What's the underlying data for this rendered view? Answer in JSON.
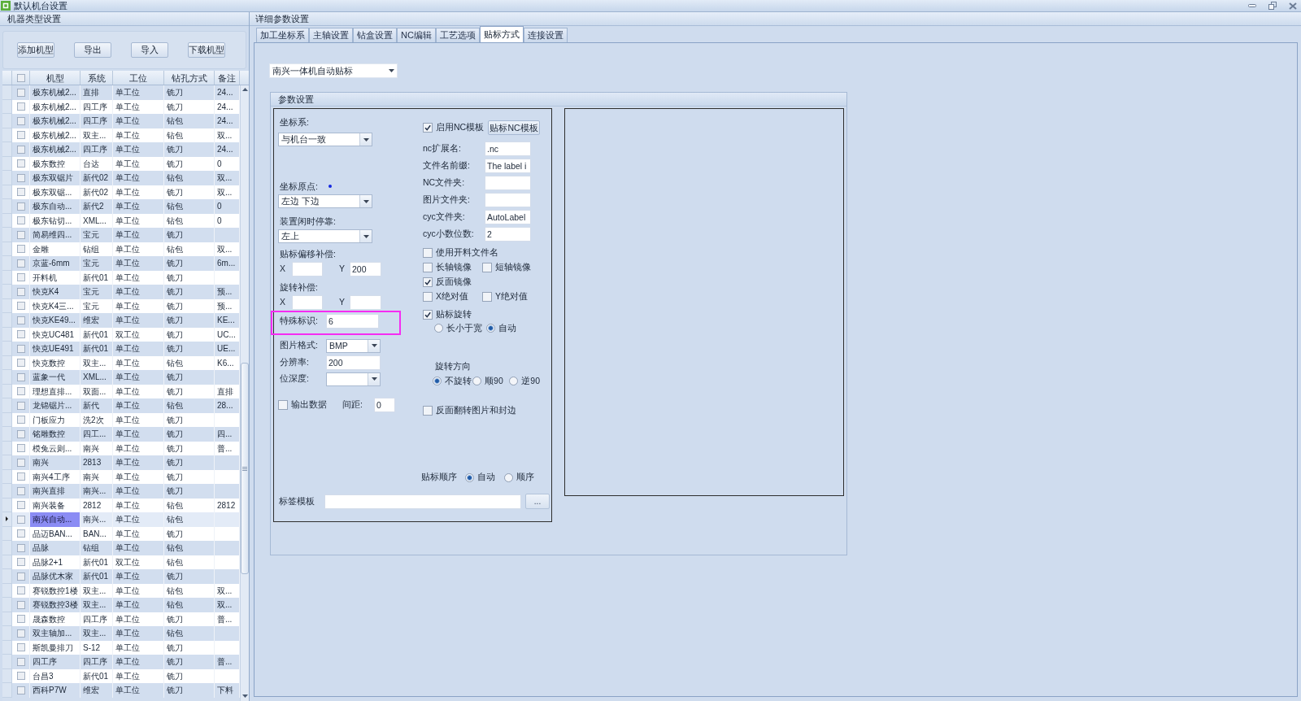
{
  "window": {
    "title": "默认机台设置"
  },
  "machine_types": {
    "title": "机器类型设置",
    "buttons": [
      "添加机型",
      "导出",
      "导入",
      "下载机型"
    ],
    "table": {
      "all_checked": false,
      "columns": [
        "机型",
        "系统",
        "工位",
        "钻孔方式",
        "备注"
      ],
      "rows": [
        {
          "model": "极东机械2...",
          "system": "直排",
          "station": "单工位",
          "drilling": "铣刀",
          "remark": "24...",
          "checked": false,
          "selected": false
        },
        {
          "model": "极东机械2...",
          "system": "四工序",
          "station": "单工位",
          "drilling": "铣刀",
          "remark": "24...",
          "checked": false,
          "selected": false
        },
        {
          "model": "极东机械2...",
          "system": "四工序",
          "station": "单工位",
          "drilling": "钻包",
          "remark": "24...",
          "checked": false,
          "selected": false
        },
        {
          "model": "极东机械2...",
          "system": "双主...",
          "station": "单工位",
          "drilling": "钻包",
          "remark": "双...",
          "checked": false,
          "selected": false
        },
        {
          "model": "极东机械2...",
          "system": "四工序",
          "station": "单工位",
          "drilling": "铣刀",
          "remark": "24...",
          "checked": false,
          "selected": false
        },
        {
          "model": "极东数控",
          "system": "台达",
          "station": "单工位",
          "drilling": "铣刀",
          "remark": "0",
          "checked": false,
          "selected": false
        },
        {
          "model": "极东双锯片",
          "system": "新代02",
          "station": "单工位",
          "drilling": "钻包",
          "remark": "双...",
          "checked": false,
          "selected": false
        },
        {
          "model": "极东双锯...",
          "system": "新代02",
          "station": "单工位",
          "drilling": "铣刀",
          "remark": "双...",
          "checked": false,
          "selected": false
        },
        {
          "model": "极东自动...",
          "system": "新代2",
          "station": "单工位",
          "drilling": "钻包",
          "remark": "0",
          "checked": false,
          "selected": false
        },
        {
          "model": "极东钻切...",
          "system": "XML...",
          "station": "单工位",
          "drilling": "钻包",
          "remark": "0",
          "checked": false,
          "selected": false
        },
        {
          "model": "简易维四...",
          "system": "宝元",
          "station": "单工位",
          "drilling": "铣刀",
          "checked": false,
          "selected": false
        },
        {
          "model": "金雕",
          "system": "钻组",
          "station": "单工位",
          "drilling": "钻包",
          "remark": "双...",
          "checked": false,
          "selected": false
        },
        {
          "model": "京蓝-6mm",
          "system": "宝元",
          "station": "单工位",
          "drilling": "铣刀",
          "remark": "6m...",
          "checked": false,
          "selected": false
        },
        {
          "model": "开料机",
          "system": "新代01",
          "station": "单工位",
          "drilling": "铣刀",
          "checked": false,
          "selected": false
        },
        {
          "model": "快克K4",
          "system": "宝元",
          "station": "单工位",
          "drilling": "铣刀",
          "remark": "预...",
          "checked": false,
          "selected": false
        },
        {
          "model": "快克K4三...",
          "system": "宝元",
          "station": "单工位",
          "drilling": "铣刀",
          "remark": "预...",
          "checked": false,
          "selected": false
        },
        {
          "model": "快克KE49...",
          "system": "维宏",
          "station": "单工位",
          "drilling": "铣刀",
          "remark": "KE...",
          "checked": false,
          "selected": false
        },
        {
          "model": "快克UC481",
          "system": "新代01",
          "station": "双工位",
          "drilling": "铣刀",
          "remark": "UC...",
          "checked": false,
          "selected": false
        },
        {
          "model": "快克UE491",
          "system": "新代01",
          "station": "单工位",
          "drilling": "铣刀",
          "remark": "UE...",
          "checked": false,
          "selected": false
        },
        {
          "model": "快克数控",
          "system": "双主...",
          "station": "单工位",
          "drilling": "钻包",
          "remark": "K6...",
          "checked": false,
          "selected": false
        },
        {
          "model": "蓝象一代",
          "system": "XML...",
          "station": "单工位",
          "drilling": "铣刀",
          "checked": false,
          "selected": false
        },
        {
          "model": "理想直排...",
          "system": "双面...",
          "station": "单工位",
          "drilling": "铣刀",
          "remark": "直排",
          "checked": false,
          "selected": false
        },
        {
          "model": "龙锦锯片...",
          "system": "新代",
          "station": "单工位",
          "drilling": "钻包",
          "remark": "28...",
          "checked": false,
          "selected": false
        },
        {
          "model": "门板应力",
          "system": "洗2次",
          "station": "单工位",
          "drilling": "铣刀",
          "checked": false,
          "selected": false
        },
        {
          "model": "铭雕数控",
          "system": "四工...",
          "station": "单工位",
          "drilling": "铣刀",
          "remark": "四...",
          "checked": false,
          "selected": false
        },
        {
          "model": "模兔云则...",
          "system": "南兴",
          "station": "单工位",
          "drilling": "铣刀",
          "remark": "普...",
          "checked": false,
          "selected": false
        },
        {
          "model": "南兴",
          "system": "2813",
          "station": "单工位",
          "drilling": "铣刀",
          "checked": false,
          "selected": false
        },
        {
          "model": "南兴4工序",
          "system": "南兴",
          "station": "单工位",
          "drilling": "铣刀",
          "checked": false,
          "selected": false
        },
        {
          "model": "南兴直排",
          "system": "南兴...",
          "station": "单工位",
          "drilling": "铣刀",
          "checked": false,
          "selected": false
        },
        {
          "model": "南兴装备",
          "system": "2812",
          "station": "单工位",
          "drilling": "钻包",
          "remark": "2812",
          "checked": false,
          "selected": false
        },
        {
          "model": "南兴自动...",
          "system": "南兴...",
          "station": "单工位",
          "drilling": "钻包",
          "checked": false,
          "selected": true
        },
        {
          "model": "品迈BAN...",
          "system": "BAN...",
          "station": "单工位",
          "drilling": "铣刀",
          "checked": false,
          "selected": false
        },
        {
          "model": "品脉",
          "system": "钻组",
          "station": "单工位",
          "drilling": "钻包",
          "checked": false,
          "selected": false
        },
        {
          "model": "品脉2+1",
          "system": "新代01",
          "station": "双工位",
          "drilling": "钻包",
          "checked": false,
          "selected": false
        },
        {
          "model": "品脉优木家",
          "system": "新代01",
          "station": "单工位",
          "drilling": "铣刀",
          "checked": false,
          "selected": false
        },
        {
          "model": "赛锐数控1楼",
          "system": "双主...",
          "station": "单工位",
          "drilling": "钻包",
          "remark": "双...",
          "checked": false,
          "selected": false
        },
        {
          "model": "赛锐数控3楼",
          "system": "双主...",
          "station": "单工位",
          "drilling": "钻包",
          "remark": "双...",
          "checked": false,
          "selected": false
        },
        {
          "model": "晟森数控",
          "system": "四工序",
          "station": "单工位",
          "drilling": "铣刀",
          "remark": "普...",
          "checked": false,
          "selected": false
        },
        {
          "model": "双主轴加...",
          "system": "双主...",
          "station": "单工位",
          "drilling": "钻包",
          "checked": false,
          "selected": false
        },
        {
          "model": "斯凯曼排刀",
          "system": "S-12",
          "station": "单工位",
          "drilling": "铣刀",
          "checked": false,
          "selected": false
        },
        {
          "model": "四工序",
          "system": "四工序",
          "station": "单工位",
          "drilling": "铣刀",
          "remark": "普...",
          "checked": false,
          "selected": false
        },
        {
          "model": "台昌3",
          "system": "新代01",
          "station": "单工位",
          "drilling": "铣刀",
          "checked": false,
          "selected": false
        },
        {
          "model": "西科P7W",
          "system": "维宏",
          "station": "单工位",
          "drilling": "铣刀",
          "remark": "下料",
          "checked": false,
          "selected": false
        }
      ]
    }
  },
  "details": {
    "title": "详细参数设置",
    "tabs": [
      {
        "label": "加工坐标系",
        "selected": false
      },
      {
        "label": "主轴设置",
        "selected": false
      },
      {
        "label": "钻盒设置",
        "selected": false
      },
      {
        "label": "NC编辑",
        "selected": false
      },
      {
        "label": "工艺选项",
        "selected": false
      },
      {
        "label": "贴标方式",
        "selected": true
      },
      {
        "label": "连接设置",
        "selected": false
      }
    ],
    "preset": {
      "value": "南兴一体机自动贴标"
    },
    "params": {
      "title": "参数设置",
      "coordinate_system": {
        "label": "坐标系:",
        "value": "与机台一致"
      },
      "origin": {
        "label": "坐标原点:",
        "value": "左边 下边"
      },
      "idle_position": {
        "label": "装置闲时停靠:",
        "value": "左上"
      },
      "label_offset": {
        "label": "贴标偏移补偿:",
        "x_label": "X",
        "y_label": "Y",
        "y_value": "200"
      },
      "rotation_offset": {
        "label": "旋转补偿:",
        "x_label": "X",
        "y_label": "Y"
      },
      "special_mark": {
        "label": "特殊标识:",
        "value": "6",
        "highlighted": true
      },
      "image_format": {
        "label": "图片格式:",
        "value": "BMP"
      },
      "resolution": {
        "label": "分辨率:",
        "value": "200"
      },
      "bit_depth": {
        "label": "位深度:"
      },
      "output_data": {
        "label": "输出数据",
        "checked": false
      },
      "spacing": {
        "label": "间距:",
        "value": "0"
      },
      "nc_template": {
        "label": "启用NC模板",
        "checked": true,
        "button": "贴标NC模板"
      },
      "text_fields": [
        {
          "label": "nc扩展名:",
          "value": ".nc"
        },
        {
          "label": "文件名前缀:",
          "value": "The label i"
        },
        {
          "label": "NC文件夹:"
        },
        {
          "label": "图片文件夹:"
        },
        {
          "label": "cyc文件夹:",
          "value": "AutoLabel"
        },
        {
          "label": "cyc小数位数:",
          "value": "2"
        }
      ],
      "option_rows": [
        {
          "items": [
            {
              "label": "使用开料文件名",
              "checked": false
            }
          ]
        },
        {
          "items": [
            {
              "label": "长轴镜像",
              "checked": false
            },
            {
              "label": "短轴镜像",
              "checked": false
            }
          ]
        },
        {
          "items": [
            {
              "label": "反面镜像",
              "checked": true
            }
          ]
        },
        {
          "items": [
            {
              "label": "X绝对值",
              "checked": false
            },
            {
              "label": "Y绝对值",
              "checked": false
            }
          ]
        }
      ],
      "label_rotation": {
        "label": "贴标旋转",
        "checked": true,
        "choices": [
          {
            "label": "长小于宽",
            "selected": false
          },
          {
            "label": "自动",
            "selected": true
          }
        ]
      },
      "rotation_direction": {
        "label": "旋转方向",
        "choices": [
          {
            "label": "不旋转",
            "selected": true
          },
          {
            "label": "顺90",
            "selected": false
          },
          {
            "label": "逆90",
            "selected": false
          }
        ]
      },
      "flip_back": {
        "label": "反面翻转图片和封边",
        "checked": false
      },
      "label_order": {
        "label": "贴标顺序",
        "choices": [
          {
            "label": "自动",
            "selected": true
          },
          {
            "label": "顺序",
            "selected": false
          }
        ]
      },
      "label_template": {
        "label": "标签模板",
        "button": "..."
      }
    }
  }
}
